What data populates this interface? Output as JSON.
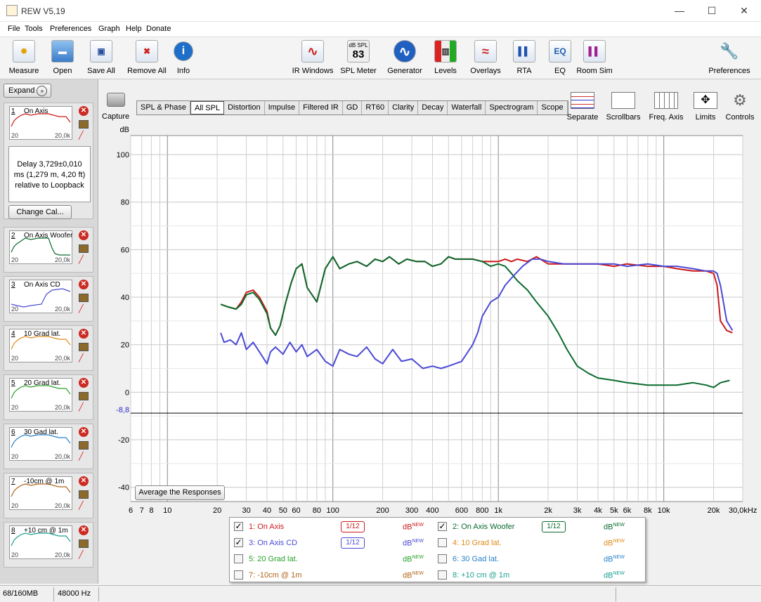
{
  "window": {
    "title": "REW V5,19",
    "minimize": "—",
    "maximize": "☐",
    "close": "✕"
  },
  "menu": [
    "File",
    "Tools",
    "Preferences",
    "Graph",
    "Help",
    "Donate"
  ],
  "toolbar_left": [
    {
      "label": "Measure",
      "icon": "measure-icon",
      "glyph": "✸"
    },
    {
      "label": "Open",
      "icon": "folder-icon",
      "glyph": "▬"
    },
    {
      "label": "Save All",
      "icon": "save-all-icon",
      "glyph": "▣"
    },
    {
      "label": "Remove All",
      "icon": "remove-all-icon",
      "glyph": "✖"
    },
    {
      "label": "Info",
      "icon": "info-icon",
      "glyph": "i"
    }
  ],
  "toolbar_center": [
    {
      "label": "IR Windows",
      "icon": "ir-windows-icon",
      "glyph": "∿"
    },
    {
      "label": "SPL Meter",
      "icon": "spl-meter-icon",
      "glyph": "83",
      "sub": "dB SPL"
    },
    {
      "label": "Generator",
      "icon": "generator-icon",
      "glyph": "∿"
    },
    {
      "label": "Levels",
      "icon": "levels-icon",
      "glyph": "▥"
    },
    {
      "label": "Overlays",
      "icon": "overlays-icon",
      "glyph": "≈"
    },
    {
      "label": "RTA",
      "icon": "rta-icon",
      "glyph": "▌▌"
    },
    {
      "label": "EQ",
      "icon": "eq-icon",
      "glyph": "EQ"
    },
    {
      "label": "Room Sim",
      "icon": "room-sim-icon",
      "glyph": "▌▌"
    }
  ],
  "toolbar_right": {
    "label": "Preferences",
    "icon": "wrench-icon"
  },
  "left_panel": {
    "expand": "Expand",
    "info_text": [
      "Delay 3,729±0,010",
      "ms (1,279 m, 4,20 ft)",
      "relative to Loopback"
    ],
    "change_cal": "Change Cal...",
    "measurements": [
      {
        "num": "1",
        "name": "On Axis",
        "color": "#cc1a1a",
        "lo": "20",
        "hi": "20,0k"
      },
      {
        "num": "2",
        "name": "On Axis Woofer",
        "color": "#0a6b2e",
        "lo": "20",
        "hi": "20,0k"
      },
      {
        "num": "3",
        "name": "On Axis CD",
        "color": "#4a4ad6",
        "lo": "20",
        "hi": "20,0k"
      },
      {
        "num": "4",
        "name": "10 Grad lat.",
        "color": "#e08a1a",
        "lo": "20",
        "hi": "20,0k"
      },
      {
        "num": "5",
        "name": "20 Grad lat.",
        "color": "#2aa12a",
        "lo": "20",
        "hi": "20,0k"
      },
      {
        "num": "6",
        "name": "30 Gad lat.",
        "color": "#2a82c8",
        "lo": "20",
        "hi": "20,0k"
      },
      {
        "num": "7",
        "name": "-10cm @ 1m",
        "color": "#b0661a",
        "lo": "20",
        "hi": "20,0k"
      },
      {
        "num": "8",
        "name": "+10 cm @ 1m",
        "color": "#1aa091",
        "lo": "20",
        "hi": "20,0k"
      }
    ]
  },
  "capture": "Capture",
  "tabs": [
    "SPL & Phase",
    "All SPL",
    "Distortion",
    "Impulse",
    "Filtered IR",
    "GD",
    "RT60",
    "Clarity",
    "Decay",
    "Waterfall",
    "Spectrogram",
    "Scope"
  ],
  "active_tab": "All SPL",
  "right_tools": [
    "Separate",
    "Scrollbars",
    "Freq. Axis",
    "Limits",
    "Controls"
  ],
  "average_button": "Average the Responses",
  "legend": {
    "dbnew_main": "dB",
    "dbnew_sup": "NEW",
    "rows": [
      {
        "label": "1: On Axis",
        "checked": true,
        "color": "#cc1a1a",
        "smoothing": "1/12"
      },
      {
        "label": "2: On Axis Woofer",
        "checked": true,
        "color": "#0a6b2e",
        "smoothing": "1/12"
      },
      {
        "label": "3: On Axis CD",
        "checked": true,
        "color": "#4a4ad6",
        "smoothing": "1/12"
      },
      {
        "label": "4: 10 Grad lat.",
        "checked": false,
        "color": "#e08a1a",
        "smoothing": ""
      },
      {
        "label": "5: 20 Grad lat.",
        "checked": false,
        "color": "#2aa12a",
        "smoothing": ""
      },
      {
        "label": "6: 30 Gad lat.",
        "checked": false,
        "color": "#2a82c8",
        "smoothing": ""
      },
      {
        "label": "7: -10cm @ 1m",
        "checked": false,
        "color": "#b0661a",
        "smoothing": ""
      },
      {
        "label": "8: +10 cm @ 1m",
        "checked": false,
        "color": "#1aa091",
        "smoothing": ""
      }
    ]
  },
  "status": {
    "memory": "68/160MB",
    "rate": "48000 Hz"
  },
  "chart_data": {
    "type": "line",
    "ylabel": "dB",
    "xscale": "log",
    "xlim": [
      6,
      30000
    ],
    "ylim": [
      -46,
      108
    ],
    "yticks": [
      100,
      80,
      60,
      40,
      20,
      0,
      -20,
      -40
    ],
    "ref_line": {
      "value": -8.8,
      "label": "-8,8"
    },
    "xticks": [
      {
        "v": 6,
        "l": "6"
      },
      {
        "v": 7,
        "l": "7"
      },
      {
        "v": 8,
        "l": "8"
      },
      {
        "v": 10,
        "l": "10"
      },
      {
        "v": 20,
        "l": "20"
      },
      {
        "v": 30,
        "l": "30"
      },
      {
        "v": 40,
        "l": "40"
      },
      {
        "v": 50,
        "l": "50"
      },
      {
        "v": 60,
        "l": "60"
      },
      {
        "v": 80,
        "l": "80"
      },
      {
        "v": 100,
        "l": "100"
      },
      {
        "v": 200,
        "l": "200"
      },
      {
        "v": 300,
        "l": "300"
      },
      {
        "v": 400,
        "l": "400"
      },
      {
        "v": 600,
        "l": "600"
      },
      {
        "v": 800,
        "l": "800"
      },
      {
        "v": 1000,
        "l": "1k"
      },
      {
        "v": 2000,
        "l": "2k"
      },
      {
        "v": 3000,
        "l": "3k"
      },
      {
        "v": 4000,
        "l": "4k"
      },
      {
        "v": 5000,
        "l": "5k"
      },
      {
        "v": 6000,
        "l": "6k"
      },
      {
        "v": 8000,
        "l": "8k"
      },
      {
        "v": 10000,
        "l": "10k"
      },
      {
        "v": 20000,
        "l": "20k"
      },
      {
        "v": 30000,
        "l": "30,0kHz"
      }
    ],
    "series": [
      {
        "name": "On Axis",
        "color": "#cc1a1a",
        "x": [
          21,
          23,
          26,
          28,
          30,
          33,
          36,
          40,
          42,
          45,
          48,
          52,
          56,
          60,
          65,
          70,
          80,
          90,
          100,
          110,
          125,
          140,
          160,
          180,
          200,
          220,
          250,
          280,
          320,
          360,
          400,
          450,
          500,
          550,
          600,
          700,
          800,
          900,
          1000,
          1100,
          1200,
          1300,
          1500,
          1700,
          2000,
          2500,
          3000,
          4000,
          5000,
          6000,
          8000,
          10000,
          12000,
          15000,
          18000,
          20000,
          21000,
          22000,
          24000,
          26000
        ],
        "y": [
          37,
          36,
          35,
          38,
          42,
          43,
          40,
          34,
          27,
          24,
          28,
          38,
          46,
          52,
          54,
          44,
          38,
          52,
          57,
          52,
          54,
          55,
          53,
          56,
          55,
          57,
          54,
          56,
          55,
          55,
          53,
          54,
          57,
          56,
          56,
          56,
          55,
          55,
          55,
          56,
          55,
          56,
          55,
          57,
          54,
          54,
          54,
          54,
          53,
          54,
          53,
          53,
          52,
          51,
          51,
          50,
          45,
          30,
          26,
          25
        ]
      },
      {
        "name": "On Axis Woofer",
        "color": "#0a6b2e",
        "x": [
          21,
          23,
          26,
          28,
          30,
          33,
          36,
          40,
          42,
          45,
          48,
          52,
          56,
          60,
          65,
          70,
          80,
          90,
          100,
          110,
          125,
          140,
          160,
          180,
          200,
          220,
          250,
          280,
          320,
          360,
          400,
          450,
          500,
          550,
          600,
          700,
          800,
          900,
          1000,
          1100,
          1200,
          1300,
          1500,
          1700,
          2000,
          2300,
          2600,
          3000,
          3500,
          4000,
          5000,
          6000,
          8000,
          10000,
          12000,
          15000,
          18000,
          20000,
          22000,
          25000
        ],
        "y": [
          37,
          36,
          35,
          37,
          41,
          42,
          39,
          33,
          27,
          24,
          28,
          38,
          46,
          52,
          54,
          44,
          38,
          52,
          57,
          52,
          54,
          55,
          53,
          56,
          55,
          57,
          54,
          56,
          55,
          55,
          53,
          54,
          57,
          56,
          56,
          56,
          55,
          53,
          54,
          53,
          50,
          47,
          43,
          38,
          32,
          25,
          18,
          11,
          8,
          6,
          5,
          4,
          3,
          3,
          3,
          4,
          3,
          2,
          4,
          5
        ]
      },
      {
        "name": "On Axis CD",
        "color": "#4a4ad6",
        "x": [
          21,
          22,
          24,
          26,
          28,
          30,
          33,
          36,
          40,
          42,
          45,
          50,
          55,
          60,
          65,
          70,
          80,
          90,
          100,
          110,
          125,
          140,
          160,
          180,
          200,
          230,
          260,
          300,
          350,
          400,
          450,
          500,
          600,
          700,
          750,
          800,
          900,
          1000,
          1100,
          1200,
          1400,
          1600,
          1800,
          2000,
          2500,
          3000,
          4000,
          5000,
          6000,
          8000,
          10000,
          12000,
          15000,
          18000,
          20000,
          21000,
          22000,
          24000,
          26000
        ],
        "y": [
          25,
          21,
          22,
          20,
          25,
          18,
          21,
          17,
          12,
          17,
          19,
          16,
          21,
          17,
          20,
          15,
          18,
          13,
          11,
          18,
          16,
          15,
          19,
          14,
          12,
          18,
          13,
          14,
          10,
          11,
          10,
          11,
          13,
          20,
          25,
          32,
          38,
          40,
          45,
          48,
          53,
          56,
          56,
          55,
          54,
          54,
          54,
          54,
          53,
          54,
          53,
          53,
          52,
          51,
          51,
          50,
          45,
          30,
          26
        ]
      }
    ]
  }
}
